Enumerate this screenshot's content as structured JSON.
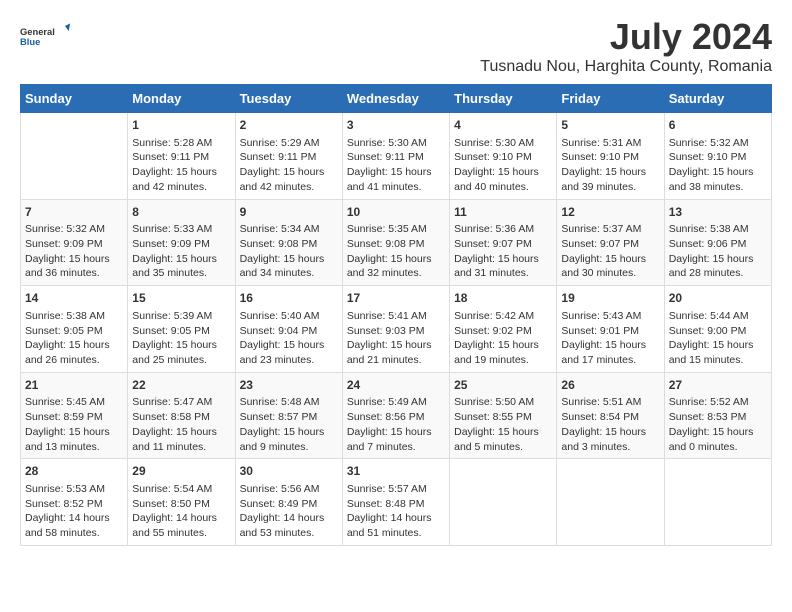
{
  "logo": {
    "general": "General",
    "blue": "Blue"
  },
  "title": "July 2024",
  "subtitle": "Tusnadu Nou, Harghita County, Romania",
  "headers": [
    "Sunday",
    "Monday",
    "Tuesday",
    "Wednesday",
    "Thursday",
    "Friday",
    "Saturday"
  ],
  "weeks": [
    [
      {
        "day": "",
        "info": ""
      },
      {
        "day": "1",
        "info": "Sunrise: 5:28 AM\nSunset: 9:11 PM\nDaylight: 15 hours\nand 42 minutes."
      },
      {
        "day": "2",
        "info": "Sunrise: 5:29 AM\nSunset: 9:11 PM\nDaylight: 15 hours\nand 42 minutes."
      },
      {
        "day": "3",
        "info": "Sunrise: 5:30 AM\nSunset: 9:11 PM\nDaylight: 15 hours\nand 41 minutes."
      },
      {
        "day": "4",
        "info": "Sunrise: 5:30 AM\nSunset: 9:10 PM\nDaylight: 15 hours\nand 40 minutes."
      },
      {
        "day": "5",
        "info": "Sunrise: 5:31 AM\nSunset: 9:10 PM\nDaylight: 15 hours\nand 39 minutes."
      },
      {
        "day": "6",
        "info": "Sunrise: 5:32 AM\nSunset: 9:10 PM\nDaylight: 15 hours\nand 38 minutes."
      }
    ],
    [
      {
        "day": "7",
        "info": "Sunrise: 5:32 AM\nSunset: 9:09 PM\nDaylight: 15 hours\nand 36 minutes."
      },
      {
        "day": "8",
        "info": "Sunrise: 5:33 AM\nSunset: 9:09 PM\nDaylight: 15 hours\nand 35 minutes."
      },
      {
        "day": "9",
        "info": "Sunrise: 5:34 AM\nSunset: 9:08 PM\nDaylight: 15 hours\nand 34 minutes."
      },
      {
        "day": "10",
        "info": "Sunrise: 5:35 AM\nSunset: 9:08 PM\nDaylight: 15 hours\nand 32 minutes."
      },
      {
        "day": "11",
        "info": "Sunrise: 5:36 AM\nSunset: 9:07 PM\nDaylight: 15 hours\nand 31 minutes."
      },
      {
        "day": "12",
        "info": "Sunrise: 5:37 AM\nSunset: 9:07 PM\nDaylight: 15 hours\nand 30 minutes."
      },
      {
        "day": "13",
        "info": "Sunrise: 5:38 AM\nSunset: 9:06 PM\nDaylight: 15 hours\nand 28 minutes."
      }
    ],
    [
      {
        "day": "14",
        "info": "Sunrise: 5:38 AM\nSunset: 9:05 PM\nDaylight: 15 hours\nand 26 minutes."
      },
      {
        "day": "15",
        "info": "Sunrise: 5:39 AM\nSunset: 9:05 PM\nDaylight: 15 hours\nand 25 minutes."
      },
      {
        "day": "16",
        "info": "Sunrise: 5:40 AM\nSunset: 9:04 PM\nDaylight: 15 hours\nand 23 minutes."
      },
      {
        "day": "17",
        "info": "Sunrise: 5:41 AM\nSunset: 9:03 PM\nDaylight: 15 hours\nand 21 minutes."
      },
      {
        "day": "18",
        "info": "Sunrise: 5:42 AM\nSunset: 9:02 PM\nDaylight: 15 hours\nand 19 minutes."
      },
      {
        "day": "19",
        "info": "Sunrise: 5:43 AM\nSunset: 9:01 PM\nDaylight: 15 hours\nand 17 minutes."
      },
      {
        "day": "20",
        "info": "Sunrise: 5:44 AM\nSunset: 9:00 PM\nDaylight: 15 hours\nand 15 minutes."
      }
    ],
    [
      {
        "day": "21",
        "info": "Sunrise: 5:45 AM\nSunset: 8:59 PM\nDaylight: 15 hours\nand 13 minutes."
      },
      {
        "day": "22",
        "info": "Sunrise: 5:47 AM\nSunset: 8:58 PM\nDaylight: 15 hours\nand 11 minutes."
      },
      {
        "day": "23",
        "info": "Sunrise: 5:48 AM\nSunset: 8:57 PM\nDaylight: 15 hours\nand 9 minutes."
      },
      {
        "day": "24",
        "info": "Sunrise: 5:49 AM\nSunset: 8:56 PM\nDaylight: 15 hours\nand 7 minutes."
      },
      {
        "day": "25",
        "info": "Sunrise: 5:50 AM\nSunset: 8:55 PM\nDaylight: 15 hours\nand 5 minutes."
      },
      {
        "day": "26",
        "info": "Sunrise: 5:51 AM\nSunset: 8:54 PM\nDaylight: 15 hours\nand 3 minutes."
      },
      {
        "day": "27",
        "info": "Sunrise: 5:52 AM\nSunset: 8:53 PM\nDaylight: 15 hours\nand 0 minutes."
      }
    ],
    [
      {
        "day": "28",
        "info": "Sunrise: 5:53 AM\nSunset: 8:52 PM\nDaylight: 14 hours\nand 58 minutes."
      },
      {
        "day": "29",
        "info": "Sunrise: 5:54 AM\nSunset: 8:50 PM\nDaylight: 14 hours\nand 55 minutes."
      },
      {
        "day": "30",
        "info": "Sunrise: 5:56 AM\nSunset: 8:49 PM\nDaylight: 14 hours\nand 53 minutes."
      },
      {
        "day": "31",
        "info": "Sunrise: 5:57 AM\nSunset: 8:48 PM\nDaylight: 14 hours\nand 51 minutes."
      },
      {
        "day": "",
        "info": ""
      },
      {
        "day": "",
        "info": ""
      },
      {
        "day": "",
        "info": ""
      }
    ]
  ]
}
